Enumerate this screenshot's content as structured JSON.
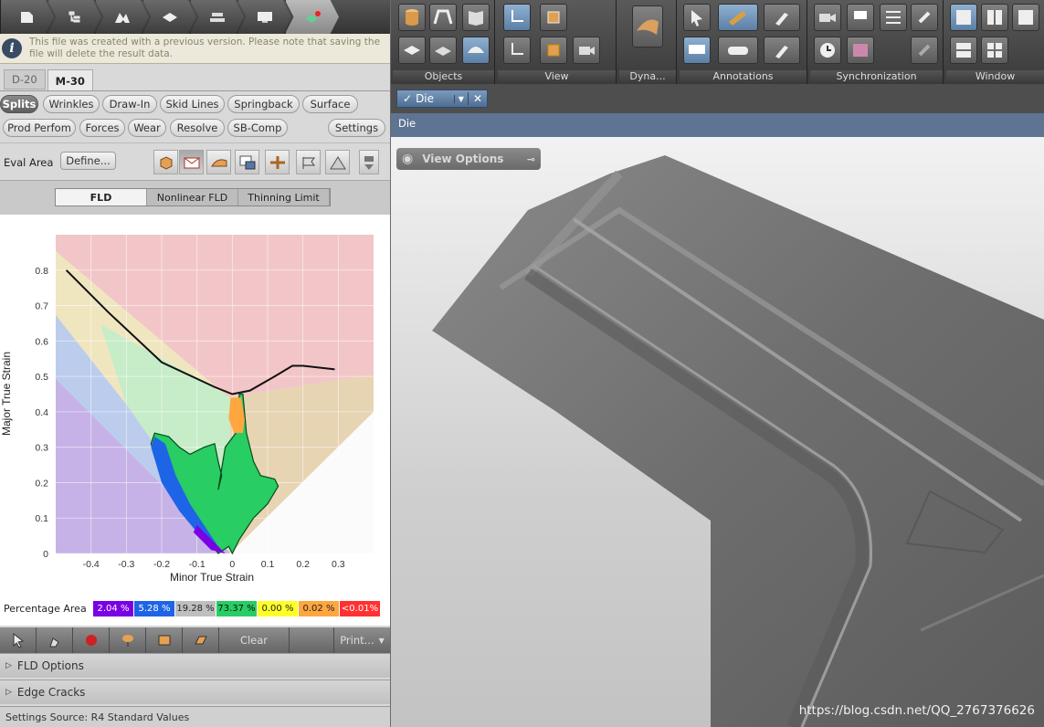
{
  "info": {
    "message": "This file was created with a previous version. Please note that saving the file will delete the result data."
  },
  "tabs": [
    "D-20",
    "M-30"
  ],
  "analysis_buttons": {
    "row1": [
      "Splits",
      "Wrinkles",
      "Draw-In",
      "Skid Lines",
      "Springback",
      "Surface"
    ],
    "row2": [
      "Prod Perfom",
      "Forces",
      "Wear",
      "Resolve",
      "SB-Comp"
    ],
    "settings": "Settings"
  },
  "eval_area": {
    "label": "Eval Area",
    "define": "Define..."
  },
  "fld_tabs": [
    "FLD",
    "Nonlinear FLD",
    "Thinning Limit"
  ],
  "chart_data": {
    "type": "scatter",
    "xlabel": "Minor True Strain",
    "ylabel": "Major True Strain",
    "xlim": [
      -0.5,
      0.4
    ],
    "ylim": [
      0,
      0.9
    ],
    "x_ticks": [
      "-0.4",
      "-0.3",
      "-0.2",
      "-0.1",
      "0",
      "0.1",
      "0.2",
      "0.3"
    ],
    "y_ticks": [
      "0",
      "0.1",
      "0.2",
      "0.3",
      "0.4",
      "0.5",
      "0.6",
      "0.7",
      "0.8"
    ],
    "flc_curve": [
      [
        -0.47,
        0.8
      ],
      [
        -0.35,
        0.68
      ],
      [
        -0.2,
        0.54
      ],
      [
        -0.05,
        0.47
      ],
      [
        0,
        0.45
      ],
      [
        0.05,
        0.46
      ],
      [
        0.12,
        0.5
      ],
      [
        0.17,
        0.53
      ],
      [
        0.2,
        0.53
      ],
      [
        0.29,
        0.52
      ]
    ],
    "point_cloud_outline": [
      [
        -0.22,
        0.34
      ],
      [
        -0.18,
        0.33
      ],
      [
        -0.15,
        0.3
      ],
      [
        -0.12,
        0.28
      ],
      [
        -0.08,
        0.3
      ],
      [
        -0.05,
        0.31
      ],
      [
        -0.04,
        0.26
      ],
      [
        -0.03,
        0.22
      ],
      [
        -0.04,
        0.18
      ],
      [
        -0.02,
        0.3
      ],
      [
        0.01,
        0.34
      ],
      [
        0.02,
        0.45
      ],
      [
        0.03,
        0.45
      ],
      [
        0.04,
        0.34
      ],
      [
        0.06,
        0.26
      ],
      [
        0.08,
        0.22
      ],
      [
        0.12,
        0.21
      ],
      [
        0.13,
        0.19
      ],
      [
        0.1,
        0.14
      ],
      [
        0.06,
        0.1
      ],
      [
        0.04,
        0.07
      ],
      [
        0.02,
        0.04
      ],
      [
        0,
        0
      ],
      [
        -0.01,
        0.02
      ],
      [
        -0.04,
        0
      ],
      [
        -0.06,
        0.03
      ],
      [
        -0.09,
        0.05
      ],
      [
        -0.11,
        0.08
      ],
      [
        -0.14,
        0.13
      ],
      [
        -0.18,
        0.18
      ],
      [
        -0.21,
        0.25
      ],
      [
        -0.23,
        0.31
      ]
    ]
  },
  "percentage_area": {
    "label": "Percentage Area",
    "cells": [
      {
        "text": "2.04 %",
        "color": "#7a00e6",
        "fg": "#ffffff"
      },
      {
        "text": "5.28 %",
        "color": "#1e64e6",
        "fg": "#ffffff"
      },
      {
        "text": "19.28 %",
        "color": "#bfbfbf",
        "fg": "#222222"
      },
      {
        "text": "73.37 %",
        "color": "#28cd64",
        "fg": "#111111"
      },
      {
        "text": "0.00 %",
        "color": "#ffff28",
        "fg": "#222222"
      },
      {
        "text": "0.02 %",
        "color": "#ffa640",
        "fg": "#222222"
      },
      {
        "text": "<0.01%",
        "color": "#ff3232",
        "fg": "#ffffff"
      }
    ]
  },
  "bottom_toolbar": {
    "clear": "Clear",
    "print": "Print..."
  },
  "accordion": [
    "FLD Options",
    "Edge Cracks"
  ],
  "status": "Settings Source:  R4 Standard Values",
  "ribbon_groups": [
    "Objects",
    "View",
    "Dyna...",
    "Annotations",
    "Synchronization",
    "Window"
  ],
  "doc_tab": "Die",
  "viewport_title": "Die",
  "view_options": "View Options",
  "watermark": "https://blog.csdn.net/QQ_2767376626"
}
